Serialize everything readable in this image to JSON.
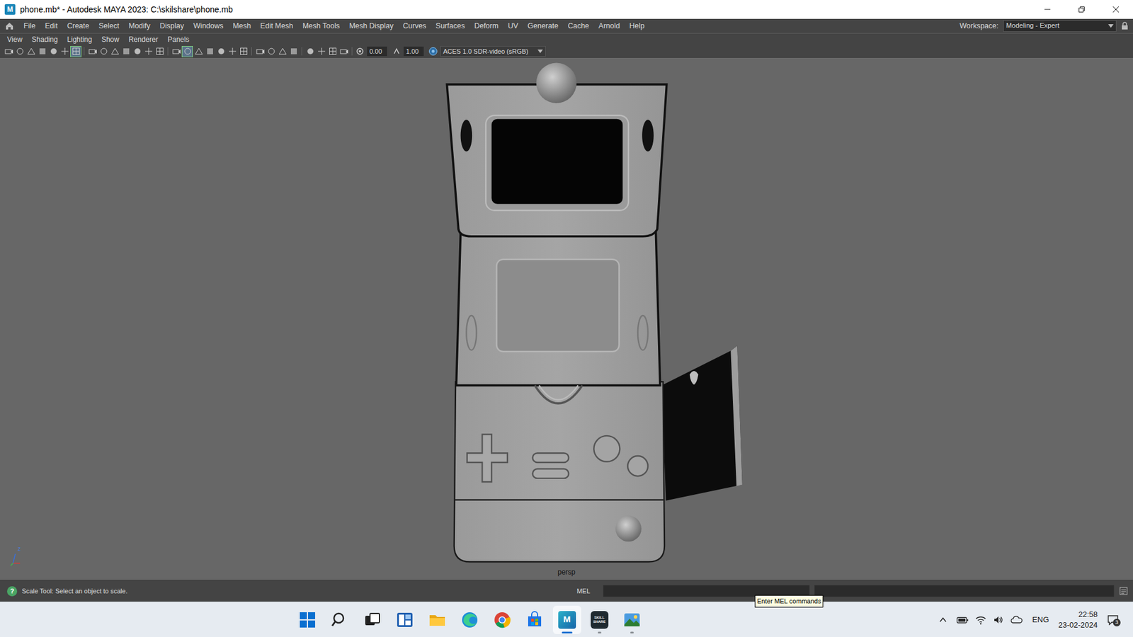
{
  "window": {
    "icon_text": "M",
    "title": "phone.mb* - Autodesk MAYA 2023: C:\\skilshare\\phone.mb"
  },
  "menu_bar": {
    "items": [
      "File",
      "Edit",
      "Create",
      "Select",
      "Modify",
      "Display",
      "Windows",
      "Mesh",
      "Edit Mesh",
      "Mesh Tools",
      "Mesh Display",
      "Curves",
      "Surfaces",
      "Deform",
      "UV",
      "Generate",
      "Cache",
      "Arnold",
      "Help"
    ],
    "workspace_label": "Workspace:",
    "workspace": "Modeling - Expert",
    "locked": true
  },
  "panel": {
    "menus": [
      "View",
      "Shading",
      "Lighting",
      "Show",
      "Renderer",
      "Panels"
    ],
    "toolbar": {
      "groups": [
        [
          {
            "on": false
          },
          {
            "on": false
          },
          {
            "on": false
          },
          {
            "on": false
          },
          {
            "on": false
          },
          {
            "on": false
          },
          {
            "on": true
          }
        ],
        [
          {
            "on": false
          },
          {
            "on": false
          },
          {
            "on": false
          },
          {
            "on": false
          },
          {
            "on": false
          },
          {
            "on": false
          },
          {
            "on": false
          }
        ],
        [
          {
            "on": false
          },
          {
            "on": true
          },
          {
            "on": false
          },
          {
            "on": false
          },
          {
            "on": false
          },
          {
            "on": false
          },
          {
            "on": false
          }
        ],
        [
          {
            "on": false
          },
          {
            "on": false
          },
          {
            "on": false
          },
          {
            "on": false
          }
        ],
        [
          {
            "on": false
          },
          {
            "on": false
          },
          {
            "on": false
          },
          {
            "on": false
          }
        ]
      ],
      "exposure": "0.00",
      "gamma": "1.00",
      "color_space": "ACES 1.0 SDR-video (sRGB)"
    }
  },
  "viewport": {
    "camera": "persp",
    "axis_label": "z"
  },
  "command_line": {
    "help_icon": "?",
    "message": "Scale Tool: Select an object to scale.",
    "language": "MEL",
    "tooltip": "Enter MEL commands"
  },
  "taskbar": {
    "apps": [
      {
        "kind": "start",
        "selected": false,
        "running": false
      },
      {
        "kind": "search",
        "selected": false,
        "running": false
      },
      {
        "kind": "taskview",
        "selected": false,
        "running": false
      },
      {
        "kind": "widgets",
        "selected": false,
        "running": false
      },
      {
        "kind": "explorer",
        "selected": false,
        "running": false
      },
      {
        "kind": "edge",
        "selected": false,
        "running": false
      },
      {
        "kind": "chrome",
        "selected": false,
        "running": false
      },
      {
        "kind": "store",
        "selected": false,
        "running": false
      },
      {
        "kind": "maya",
        "selected": true,
        "running": true,
        "logo_text": "M"
      },
      {
        "kind": "skillshare",
        "selected": false,
        "running": true,
        "logo_text": "SKILL SHARE"
      },
      {
        "kind": "photos",
        "selected": false,
        "running": true
      }
    ],
    "language": "ENG",
    "time": "22:58",
    "date": "23-02-2024",
    "notifications": "3"
  }
}
